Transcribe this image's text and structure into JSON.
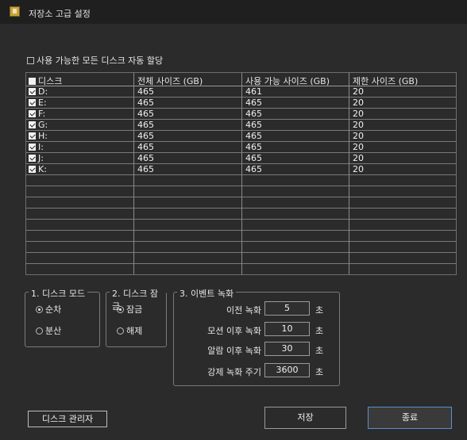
{
  "window": {
    "title": "저장소 고급 설정"
  },
  "auto_alloc": {
    "label": "사용 가능한 모든 디스크 자동 할당",
    "checked": false
  },
  "table": {
    "headers": [
      "디스크",
      "전체 사이즈 (GB)",
      "사용 가능 사이즈 (GB)",
      "제한 사이즈 (GB)"
    ],
    "rows": [
      {
        "disk": "D:",
        "total": "465",
        "avail": "461",
        "limit": "20",
        "checked": true
      },
      {
        "disk": "E:",
        "total": "465",
        "avail": "465",
        "limit": "20",
        "checked": true
      },
      {
        "disk": "F:",
        "total": "465",
        "avail": "465",
        "limit": "20",
        "checked": true
      },
      {
        "disk": "G:",
        "total": "465",
        "avail": "465",
        "limit": "20",
        "checked": true
      },
      {
        "disk": "H:",
        "total": "465",
        "avail": "465",
        "limit": "20",
        "checked": true
      },
      {
        "disk": "I:",
        "total": "465",
        "avail": "465",
        "limit": "20",
        "checked": true
      },
      {
        "disk": "J:",
        "total": "465",
        "avail": "465",
        "limit": "20",
        "checked": true
      },
      {
        "disk": "K:",
        "total": "465",
        "avail": "465",
        "limit": "20",
        "checked": true
      }
    ],
    "empty_rows": 8
  },
  "disk_mode": {
    "title": "1. 디스크 모드",
    "options": [
      {
        "label": "순차",
        "selected": true
      },
      {
        "label": "분산",
        "selected": false
      }
    ]
  },
  "disk_lock": {
    "title": "2. 디스크 잠금",
    "options": [
      {
        "label": "잠금",
        "selected": true
      },
      {
        "label": "해제",
        "selected": false
      }
    ]
  },
  "event_rec": {
    "title": "3. 이벤트 녹화",
    "unit": "초",
    "items": [
      {
        "label": "이전 녹화",
        "value": "5"
      },
      {
        "label": "모션 이후 녹화",
        "value": "10"
      },
      {
        "label": "알람 이후 녹화",
        "value": "30"
      },
      {
        "label": "강제 녹화 주기",
        "value": "3600"
      }
    ]
  },
  "buttons": {
    "disk_manager": "디스크 관리자",
    "save": "저장",
    "close": "종료"
  }
}
